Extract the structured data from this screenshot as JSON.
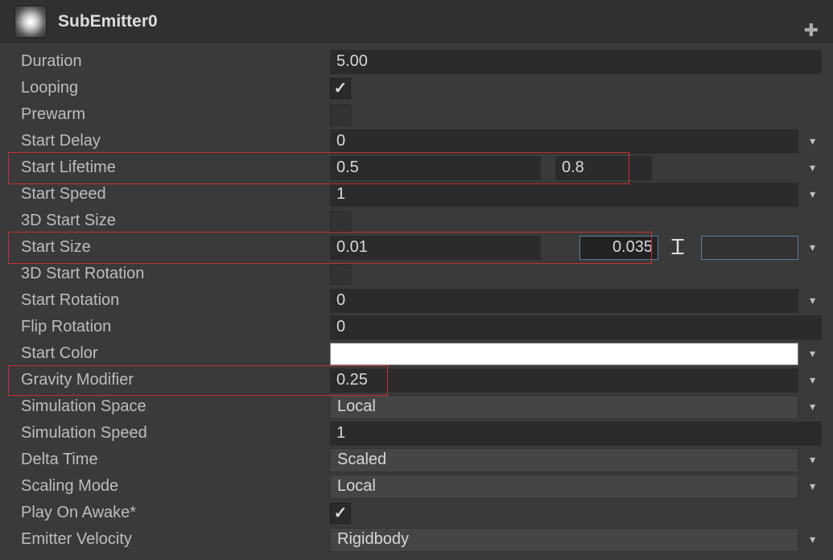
{
  "header": {
    "title": "SubEmitter0"
  },
  "fields": {
    "duration": {
      "label": "Duration",
      "value": "5.00"
    },
    "looping": {
      "label": "Looping",
      "checked": true
    },
    "prewarm": {
      "label": "Prewarm",
      "checked": false
    },
    "startDelay": {
      "label": "Start Delay",
      "value": "0"
    },
    "startLifetime": {
      "label": "Start Lifetime",
      "valueA": "0.5",
      "valueB": "0.8"
    },
    "startSpeed": {
      "label": "Start Speed",
      "value": "1"
    },
    "threeDStartSize": {
      "label": "3D Start Size",
      "checked": false
    },
    "startSize": {
      "label": "Start Size",
      "valueA": "0.01",
      "valueB": "0.035"
    },
    "threeDStartRotation": {
      "label": "3D Start Rotation",
      "checked": false
    },
    "startRotation": {
      "label": "Start Rotation",
      "value": "0"
    },
    "flipRotation": {
      "label": "Flip Rotation",
      "value": "0"
    },
    "startColor": {
      "label": "Start Color",
      "value": "#ffffff"
    },
    "gravityModifier": {
      "label": "Gravity Modifier",
      "value": "0.25"
    },
    "simulationSpace": {
      "label": "Simulation Space",
      "value": "Local"
    },
    "simulationSpeed": {
      "label": "Simulation Speed",
      "value": "1"
    },
    "deltaTime": {
      "label": "Delta Time",
      "value": "Scaled"
    },
    "scalingMode": {
      "label": "Scaling Mode",
      "value": "Local"
    },
    "playOnAwake": {
      "label": "Play On Awake*",
      "checked": true
    },
    "emitterVelocity": {
      "label": "Emitter Velocity",
      "value": "Rigidbody"
    }
  }
}
